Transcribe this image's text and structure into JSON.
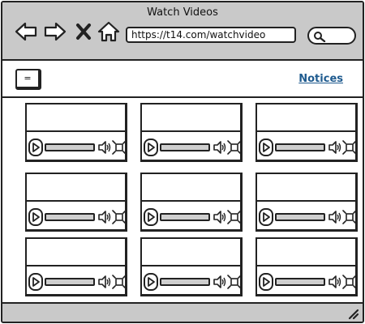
{
  "window": {
    "title": "Watch Videos"
  },
  "browser": {
    "url": "https://t14.com/watchvideo",
    "nav_icons": [
      "back-arrow-icon",
      "forward-arrow-icon",
      "close-x-icon",
      "home-icon"
    ],
    "search_icon": "search-icon"
  },
  "toolbar": {
    "menu_label": "=",
    "notices_label": "Notices",
    "link_color": "#1f5b8f"
  },
  "videos": {
    "rows": 3,
    "columns": 3,
    "items": [
      {
        "progress": 1.0
      },
      {
        "progress": 1.0
      },
      {
        "progress": 1.0
      },
      {
        "progress": 1.0
      },
      {
        "progress": 1.0
      },
      {
        "progress": 1.0
      },
      {
        "progress": 1.0
      },
      {
        "progress": 1.0
      },
      {
        "progress": 1.0
      }
    ],
    "control_icons": [
      "play-icon",
      "volume-icon",
      "fullscreen-icon"
    ]
  },
  "colors": {
    "chrome": "#c9c9c9",
    "border": "#222222",
    "progress_track": "#cfcfcf"
  }
}
